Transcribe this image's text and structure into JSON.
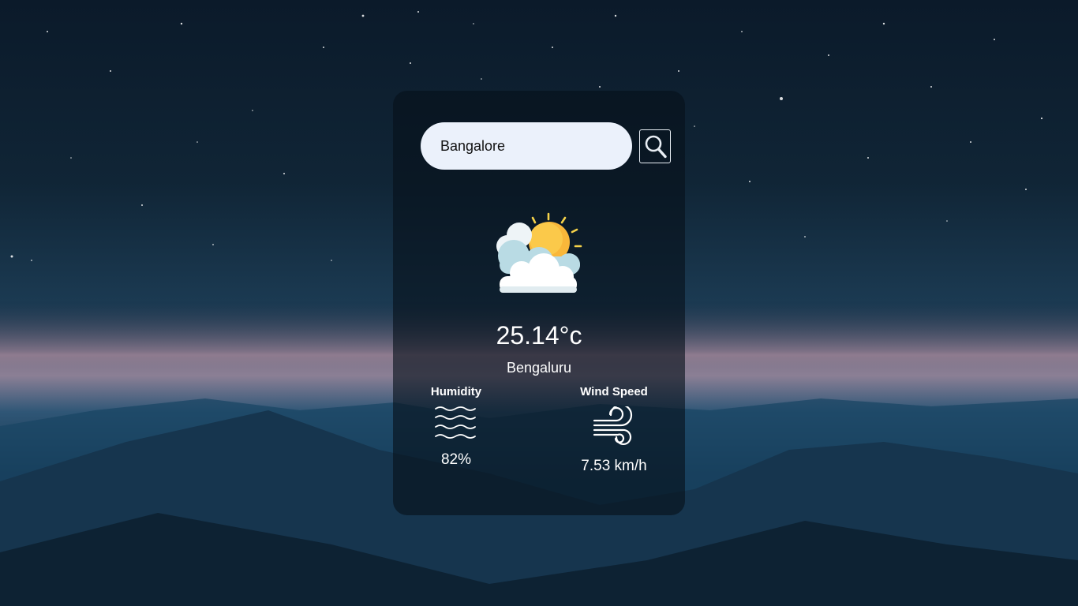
{
  "search": {
    "value": "Bangalore",
    "placeholder": "",
    "button_icon": "search-icon"
  },
  "weather": {
    "icon": "partly-cloudy-sun-icon",
    "temperature": "25.14°c",
    "city": "Bengaluru"
  },
  "stats": {
    "humidity": {
      "label": "Humidity",
      "icon": "humidity-waves-icon",
      "value": "82%"
    },
    "wind": {
      "label": "Wind Speed",
      "icon": "wind-icon",
      "value": "7.53 km/h"
    }
  },
  "colors": {
    "card_bg": "#06101a",
    "input_bg": "#ebf1fb",
    "text": "#ffffff",
    "sun": "#f9b73a",
    "cloud": "#eef4f7"
  }
}
